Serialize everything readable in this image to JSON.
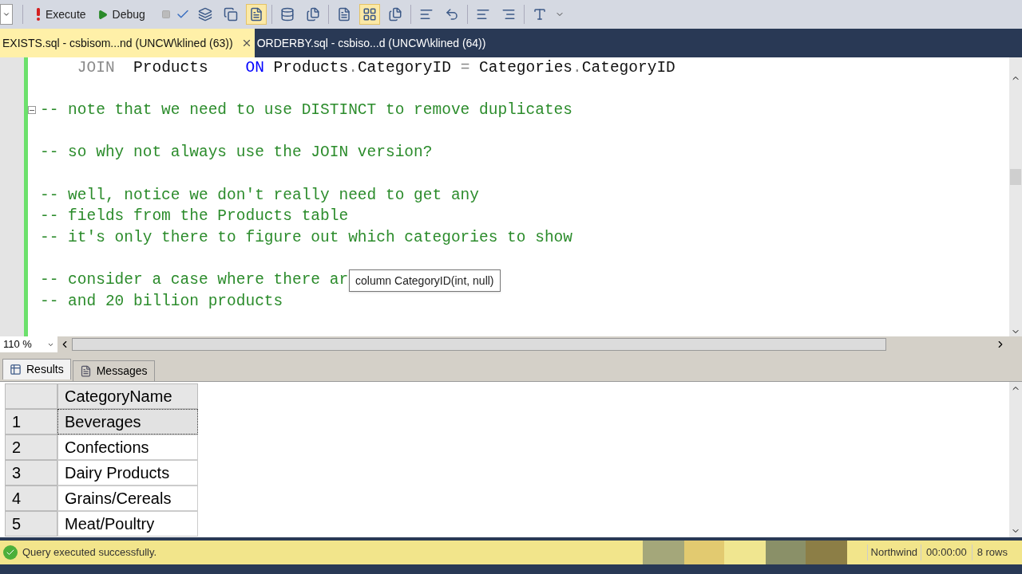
{
  "toolbar": {
    "buttons": [
      {
        "label": "Execute",
        "kind": "execute"
      },
      {
        "label": "Debug",
        "kind": "debug"
      }
    ]
  },
  "tabs": [
    {
      "label": "EXISTS.sql - csbisom...nd (UNCW\\klined (63))",
      "selected": true
    },
    {
      "label": "ORDERBY.sql - csbiso...d (UNCW\\klined (64))",
      "selected": false
    }
  ],
  "editor": {
    "lines": [
      {
        "kind": "code",
        "fold_marker": false,
        "segments": [
          {
            "text": "    JOIN  ",
            "kind": "gray"
          },
          {
            "text": "Products    ",
            "kind": "plain"
          },
          {
            "text": "ON ",
            "kind": "keyword"
          },
          {
            "text": "Products",
            "kind": "plain"
          },
          {
            "text": ".",
            "kind": "gray"
          },
          {
            "text": "CategoryID ",
            "kind": "plain"
          },
          {
            "text": "=",
            "kind": "gray"
          },
          {
            "text": " Categories",
            "kind": "plain"
          },
          {
            "text": ".",
            "kind": "gray"
          },
          {
            "text": "CategoryID",
            "kind": "plain"
          }
        ]
      },
      {
        "kind": "blank"
      },
      {
        "kind": "comment",
        "fold_marker": true,
        "text": "-- note that we need to use DISTINCT to remove duplicates"
      },
      {
        "kind": "blank"
      },
      {
        "kind": "comment",
        "fold_marker": false,
        "text": "-- so why not always use the JOIN version?"
      },
      {
        "kind": "blank"
      },
      {
        "kind": "comment",
        "fold_marker": false,
        "text": "-- well, notice we don't really need to get any"
      },
      {
        "kind": "comment",
        "fold_marker": false,
        "text": "-- fields from the Products table"
      },
      {
        "kind": "comment",
        "fold_marker": false,
        "text": "-- it's only there to figure out which categories to show"
      },
      {
        "kind": "blank"
      },
      {
        "kind": "comment",
        "fold_marker": false,
        "text": "-- consider a case where there ar"
      },
      {
        "kind": "comment",
        "fold_marker": false,
        "text": "-- and 20 billion products"
      }
    ],
    "tooltip": "column CategoryID(int, null)"
  },
  "zoom": "110 %",
  "result_tabs": [
    {
      "label": "Results",
      "kind": "grid",
      "selected": true
    },
    {
      "label": "Messages",
      "kind": "messages",
      "selected": false
    }
  ],
  "grid": {
    "columns": [
      "CategoryName"
    ],
    "rows": [
      {
        "number": "1",
        "cells": [
          "Beverages"
        ],
        "selected": true
      },
      {
        "number": "2",
        "cells": [
          "Confections"
        ],
        "selected": false
      },
      {
        "number": "3",
        "cells": [
          "Dairy Products"
        ],
        "selected": false
      },
      {
        "number": "4",
        "cells": [
          "Grains/Cereals"
        ],
        "selected": false
      },
      {
        "number": "5",
        "cells": [
          "Meat/Poultry"
        ],
        "selected": false
      }
    ]
  },
  "status_bar": {
    "message": "Query executed successfully.",
    "database": "Northwind",
    "elapsed": "00:00:00",
    "rows": "8 rows"
  }
}
